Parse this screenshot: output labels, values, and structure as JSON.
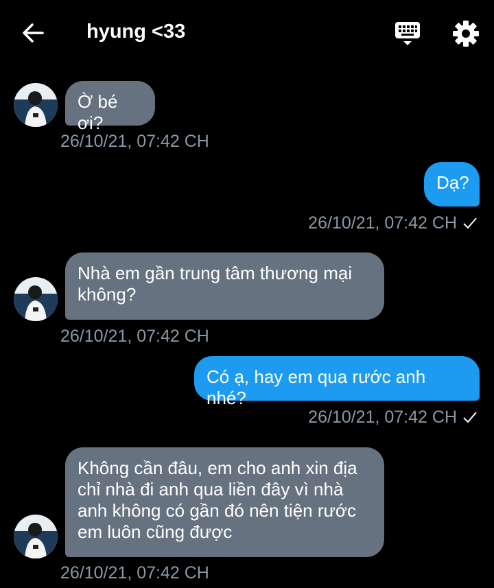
{
  "header": {
    "title": "hyung <33",
    "back_icon": "arrow-left-icon",
    "keyboard_icon": "keyboard-icon",
    "settings_icon": "gear-icon"
  },
  "colors": {
    "background": "#000000",
    "incoming_bubble": "#66727f",
    "outgoing_bubble": "#1d9bf0",
    "timestamp": "#8b98a5"
  },
  "messages": [
    {
      "direction": "in",
      "text": "Ờ bé ơi?",
      "time": "26/10/21, 07:42 CH"
    },
    {
      "direction": "out",
      "text": "Dạ?",
      "time": "26/10/21, 07:42 CH"
    },
    {
      "direction": "in",
      "text": "Nhà em gần trung tâm thương mại không?",
      "time": "26/10/21, 07:42 CH"
    },
    {
      "direction": "out",
      "text": "Có ạ, hay em qua rước anh nhé?",
      "time": "26/10/21, 07:42 CH"
    },
    {
      "direction": "in",
      "text": "Không cần đâu, em cho anh xin địa chỉ nhà đi anh qua liền đây vì nhà anh không có gần đó nên tiện rước em luôn cũng được",
      "time": "26/10/21, 07:42 CH"
    }
  ]
}
